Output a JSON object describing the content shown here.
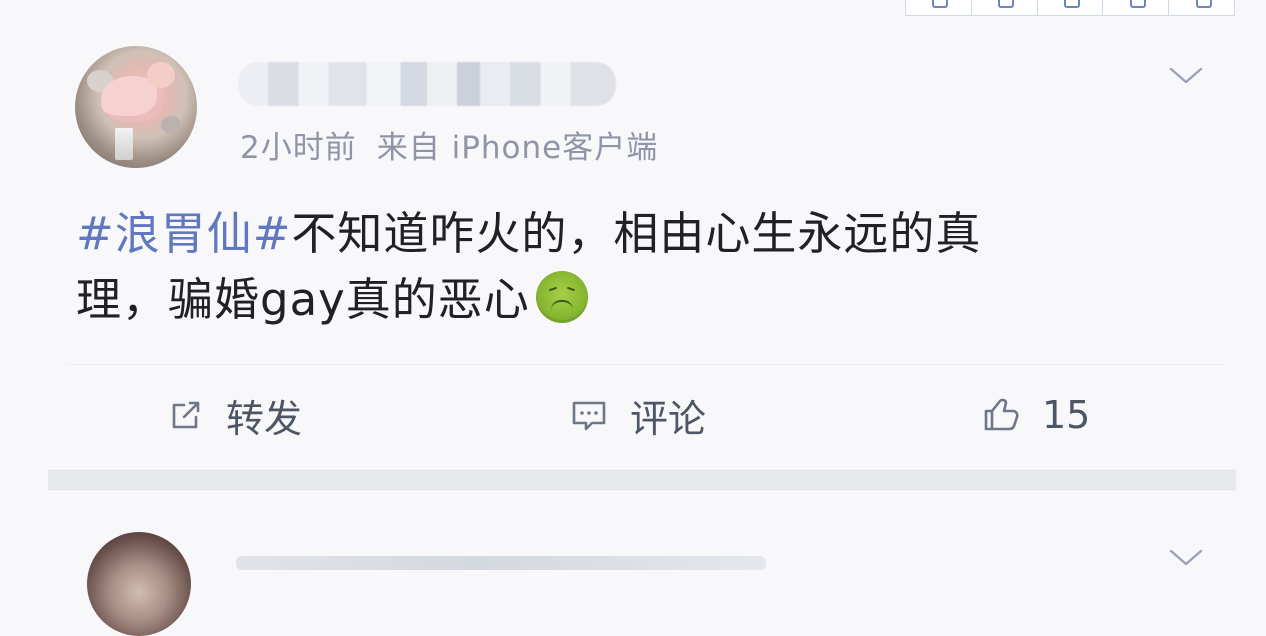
{
  "post": {
    "time": "2小时前",
    "source": "来自 iPhone客户端",
    "content_hashtag": "#浪胃仙#",
    "content_line_1_rest": "不知道咋火的，相由心生永远的真",
    "content_line_2": "理，骗婚gay真的恶心",
    "emoji": "sick-face-emoji"
  },
  "actions": {
    "repost_label": "转发",
    "comment_label": "评论",
    "like_count": "15"
  },
  "icons": {
    "dropdown": "chevron-down-icon",
    "repost": "repost-icon",
    "comment": "comment-icon",
    "like": "thumb-up-icon"
  },
  "colors": {
    "page_background": "#f8f8fb",
    "hashtag": "#5f78bf",
    "body_text": "#202124",
    "meta_text": "#8f95a6",
    "action_text": "#4e5565",
    "separator": "#e8e9ed",
    "emoji_green": "#8bbb34"
  }
}
